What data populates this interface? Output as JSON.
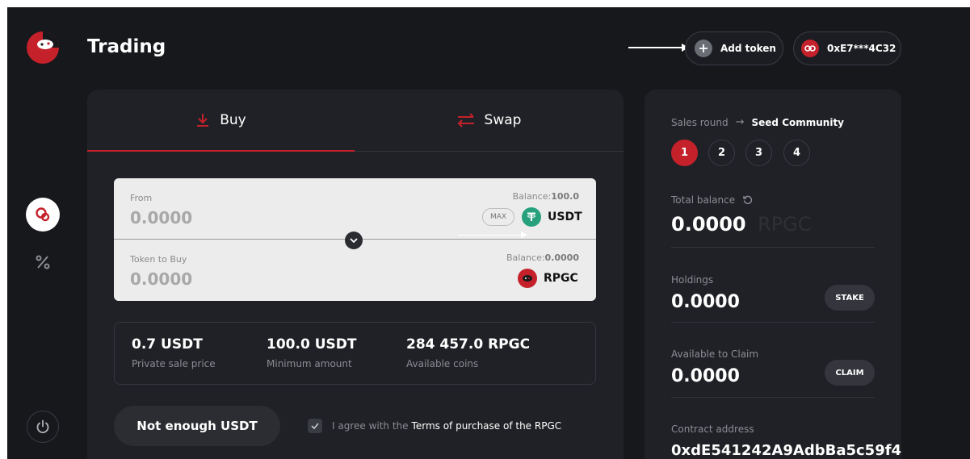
{
  "header": {
    "title": "Trading",
    "add_token_label": "Add token",
    "wallet_address": "0xE7***4C32"
  },
  "tabs": [
    {
      "label": "Buy",
      "active": true
    },
    {
      "label": "Swap",
      "active": false
    }
  ],
  "form": {
    "from_label": "From",
    "from_value": "0.0000",
    "from_balance_label": "Balance:",
    "from_balance_value": "100.0",
    "max_label": "MAX",
    "from_token": "USDT",
    "to_label": "Token to Buy",
    "to_value": "0.0000",
    "to_balance_label": "Balance:",
    "to_balance_value": "0.0000",
    "to_token": "RPGC"
  },
  "stats": [
    {
      "value": "0.7 USDT",
      "label": "Private sale price"
    },
    {
      "value": "100.0 USDT",
      "label": "Minimum amount"
    },
    {
      "value": "284 457.0 RPGC",
      "label": "Available coins"
    }
  ],
  "action": {
    "button_label": "Not enough USDT",
    "agree_text": "I agree with the",
    "agree_link": "Terms of purchase of the RPGC"
  },
  "sidebar_info": {
    "sales_round_label": "Sales round",
    "sales_round_arrow": "→",
    "sales_round_value": "Seed Community",
    "rounds": [
      "1",
      "2",
      "3",
      "4"
    ],
    "active_round": "1",
    "total_balance_label": "Total balance",
    "total_balance_value": "0.0000",
    "total_balance_unit": "RPGC",
    "holdings_label": "Holdings",
    "holdings_value": "0.0000",
    "stake_label": "STAKE",
    "claim_label_text": "Available to Claim",
    "claim_value": "0.0000",
    "claim_button": "CLAIM",
    "contract_label": "Contract address",
    "contract_value": "0xdE541242A9AdbBa5c59f4"
  },
  "colors": {
    "accent": "#c4212b",
    "background": "#17181c",
    "panel": "#202126",
    "usdt": "#26a17b"
  }
}
